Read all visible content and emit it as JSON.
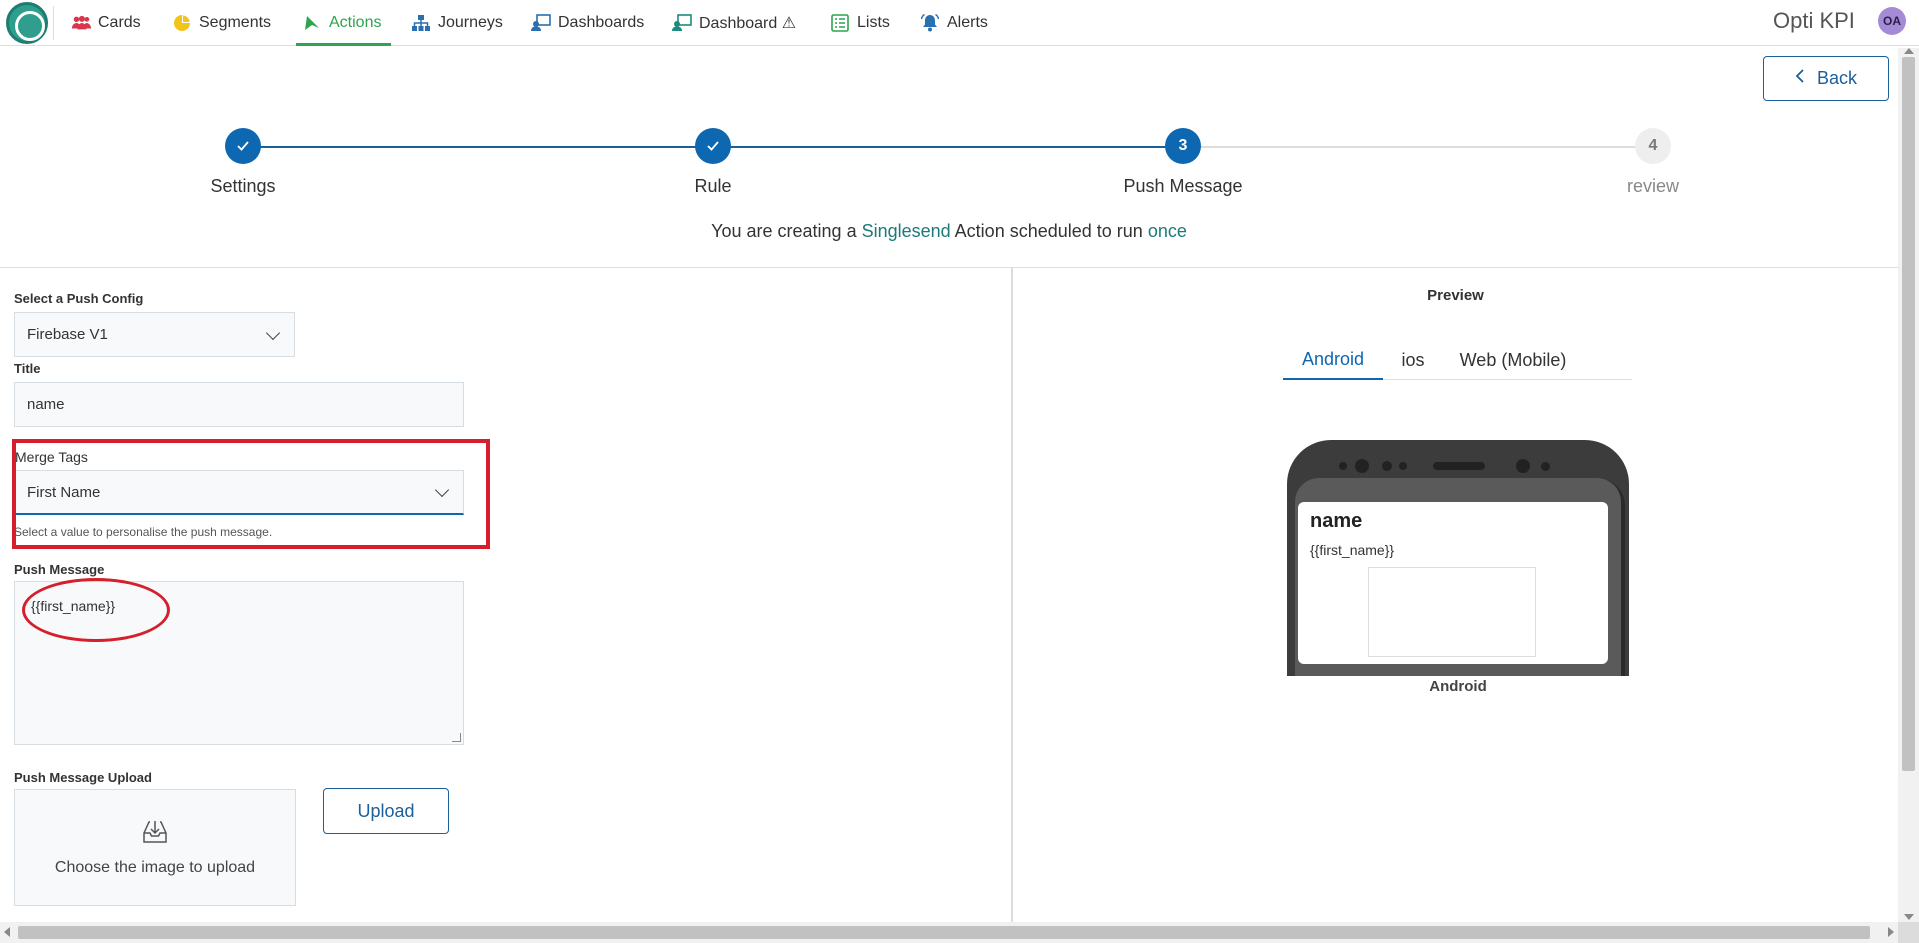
{
  "nav": {
    "items": [
      {
        "label": "Cards",
        "icon": "users-icon"
      },
      {
        "label": "Segments",
        "icon": "pie-chart-icon"
      },
      {
        "label": "Actions",
        "icon": "send-icon",
        "active": true
      },
      {
        "label": "Journeys",
        "icon": "sitemap-icon"
      },
      {
        "label": "Dashboards",
        "icon": "dashboard-icon"
      },
      {
        "label": "Dashboard ⚠",
        "icon": "dashboard-icon"
      },
      {
        "label": "Lists",
        "icon": "list-icon"
      },
      {
        "label": "Alerts",
        "icon": "bell-icon"
      }
    ],
    "brand": "Opti KPI",
    "avatar_initials": "OA"
  },
  "back_label": "Back",
  "stepper": {
    "steps": [
      {
        "label": "Settings",
        "state": "done"
      },
      {
        "label": "Rule",
        "state": "done"
      },
      {
        "label": "Push Message",
        "state": "current",
        "number": "3"
      },
      {
        "label": "review",
        "state": "todo",
        "number": "4"
      }
    ]
  },
  "info": {
    "prefix": "You are creating a ",
    "type": "Singlesend",
    "middle": " Action scheduled to run ",
    "schedule": "once"
  },
  "form": {
    "push_config_label": "Select a Push Config",
    "push_config_value": "Firebase V1",
    "title_label": "Title",
    "title_value": "name",
    "merge_tags_label": "Merge Tags",
    "merge_tags_value": "First Name",
    "merge_tags_hint": "Select a value to personalise the push message.",
    "push_message_label": "Push Message",
    "push_message_value": "{{first_name}}",
    "upload_label": "Push Message Upload",
    "upload_box_text": "Choose the image to upload",
    "upload_button": "Upload"
  },
  "preview": {
    "title": "Preview",
    "tabs": [
      "Android",
      "ios",
      "Web (Mobile)"
    ],
    "active_tab": "Android",
    "notification_title": "name",
    "notification_body": "{{first_name}}",
    "device_caption": "Android"
  },
  "colors": {
    "accent": "#0d67b1",
    "nav_active": "#2ea44f",
    "highlight_text": "#1c7a78",
    "annotation_red": "#d61f2c"
  }
}
